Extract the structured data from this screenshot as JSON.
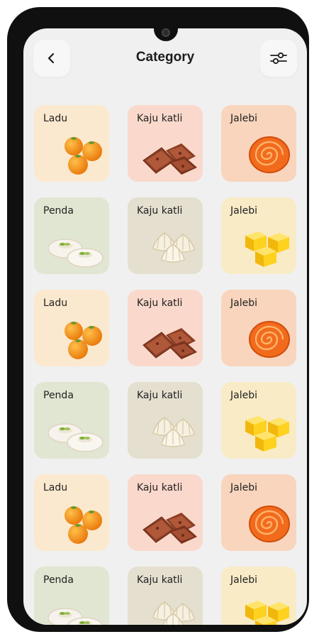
{
  "header": {
    "title": "Category",
    "back_icon": "chevron-left-icon",
    "filter_icon": "sliders-icon"
  },
  "colors": {
    "ladu_bg": "#fbe9cf",
    "kaju_bg": "#fad9cc",
    "jalebi_bg": "#f9d5bd",
    "penda_bg": "#e1e6d2",
    "modak_bg": "#e5dfcf",
    "barfi_bg": "#f8ebc6"
  },
  "categories": [
    {
      "label": "Ladu",
      "art": "ladu"
    },
    {
      "label": "Kaju katli",
      "art": "kaju"
    },
    {
      "label": "Jalebi",
      "art": "jalebi"
    },
    {
      "label": "Penda",
      "art": "penda"
    },
    {
      "label": "Kaju katli",
      "art": "modak"
    },
    {
      "label": "Jalebi",
      "art": "barfi"
    },
    {
      "label": "Ladu",
      "art": "ladu"
    },
    {
      "label": "Kaju katli",
      "art": "kaju"
    },
    {
      "label": "Jalebi",
      "art": "jalebi"
    },
    {
      "label": "Penda",
      "art": "penda"
    },
    {
      "label": "Kaju katli",
      "art": "modak"
    },
    {
      "label": "Jalebi",
      "art": "barfi"
    },
    {
      "label": "Ladu",
      "art": "ladu"
    },
    {
      "label": "Kaju katli",
      "art": "kaju"
    },
    {
      "label": "Jalebi",
      "art": "jalebi"
    },
    {
      "label": "Penda",
      "art": "penda"
    },
    {
      "label": "Kaju katli",
      "art": "modak"
    },
    {
      "label": "Jalebi",
      "art": "barfi"
    }
  ]
}
